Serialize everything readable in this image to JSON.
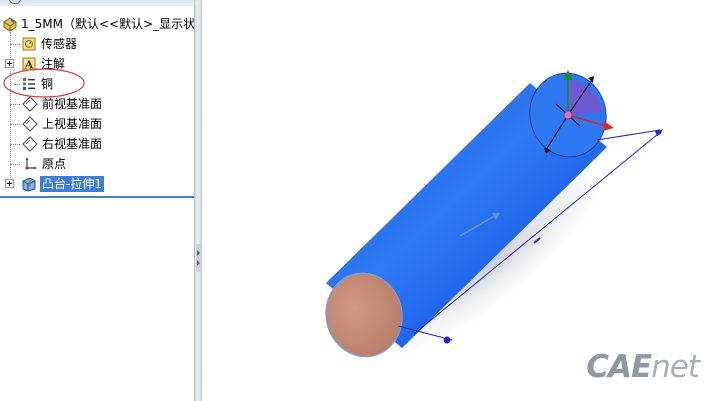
{
  "tree": {
    "root_label": "1_5MM（默认<<默认>_显示状",
    "items": [
      {
        "label": "传感器",
        "icon": "sensor-icon",
        "expandable": false
      },
      {
        "label": "注解",
        "icon": "annotation-icon",
        "expandable": true
      },
      {
        "label": "铜",
        "icon": "material-icon",
        "expandable": false
      },
      {
        "label": "前视基准面",
        "icon": "plane-icon",
        "expandable": false
      },
      {
        "label": "上视基准面",
        "icon": "plane-icon",
        "expandable": false
      },
      {
        "label": "右视基准面",
        "icon": "plane-icon",
        "expandable": false
      },
      {
        "label": "原点",
        "icon": "origin-icon",
        "expandable": false
      },
      {
        "label": "凸台-拉伸1",
        "icon": "extrude-icon",
        "expandable": true,
        "selected": true
      }
    ]
  },
  "annotation_circle_color": "#d9363e",
  "selection_color": "#3d7edb",
  "model": {
    "body_color": "#2a6ff0",
    "end_face_color": "#c48a76",
    "dimension_color": "#1a22c8"
  },
  "watermark": {
    "part1": "CAE",
    "part2": "net"
  }
}
